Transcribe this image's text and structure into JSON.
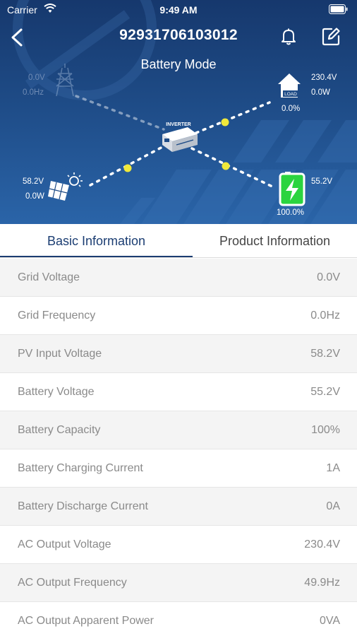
{
  "status_bar": {
    "carrier": "Carrier",
    "time": "9:49 AM"
  },
  "header": {
    "device_id": "92931706103012",
    "mode": "Battery Mode"
  },
  "diagram": {
    "inverter_label": "INVERTER",
    "load_label": "LOAD",
    "grid": {
      "voltage": "0.0V",
      "frequency": "0.0Hz"
    },
    "load": {
      "voltage": "230.4V",
      "power": "0.0W",
      "percent": "0.0%"
    },
    "pv": {
      "voltage": "58.2V",
      "power": "0.0W"
    },
    "battery": {
      "voltage": "55.2V",
      "percent": "100.0%"
    }
  },
  "tabs": {
    "basic": "Basic Information",
    "product": "Product Information"
  },
  "rows": [
    {
      "label": "Grid Voltage",
      "value": "0.0V"
    },
    {
      "label": "Grid Frequency",
      "value": "0.0Hz"
    },
    {
      "label": "PV Input Voltage",
      "value": "58.2V"
    },
    {
      "label": "Battery Voltage",
      "value": "55.2V"
    },
    {
      "label": "Battery Capacity",
      "value": "100%"
    },
    {
      "label": "Battery Charging Current",
      "value": "1A"
    },
    {
      "label": "Battery Discharge Current",
      "value": "0A"
    },
    {
      "label": "AC Output Voltage",
      "value": "230.4V"
    },
    {
      "label": "AC Output Frequency",
      "value": "49.9Hz"
    },
    {
      "label": "AC Output Apparent Power",
      "value": "0VA"
    }
  ],
  "colors": {
    "header_bg": "#1e4b86",
    "accent": "#1b3d72",
    "battery_green": "#2bd43f",
    "flow_dot": "#f0e83a"
  }
}
